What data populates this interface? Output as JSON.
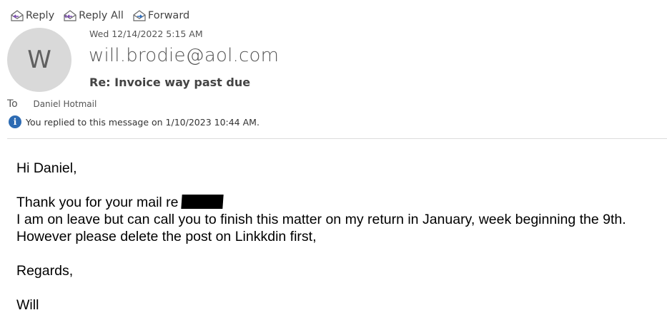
{
  "toolbar": {
    "reply_label": "Reply",
    "reply_all_label": "Reply All",
    "forward_label": "Forward"
  },
  "message": {
    "avatar_initial": "W",
    "date": "Wed 12/14/2022 5:15 AM",
    "sender": "will.brodie@aol.com",
    "subject": "Re: Invoice way past due",
    "to_label": "To",
    "to_name": "Daniel Hotmail",
    "info_text": "You replied to this message on 1/10/2023 10:44 AM."
  },
  "body": {
    "greeting": "Hi Daniel,",
    "line1": "Thank you for your mail re",
    "line2": "I am on leave but can call you to finish this matter on my return in January, week beginning the 9th.",
    "line3": "However please delete the post on Linkkdin first,",
    "closing": "Regards,",
    "signature": "Will"
  },
  "icons": {
    "reply": "reply-envelope-icon",
    "reply_all": "reply-all-envelope-icon",
    "forward": "forward-envelope-icon",
    "info": "info-icon"
  },
  "colors": {
    "info_blue": "#2d6bb3",
    "reply_purple": "#7a4bb0",
    "forward_blue": "#2f6fc0"
  }
}
